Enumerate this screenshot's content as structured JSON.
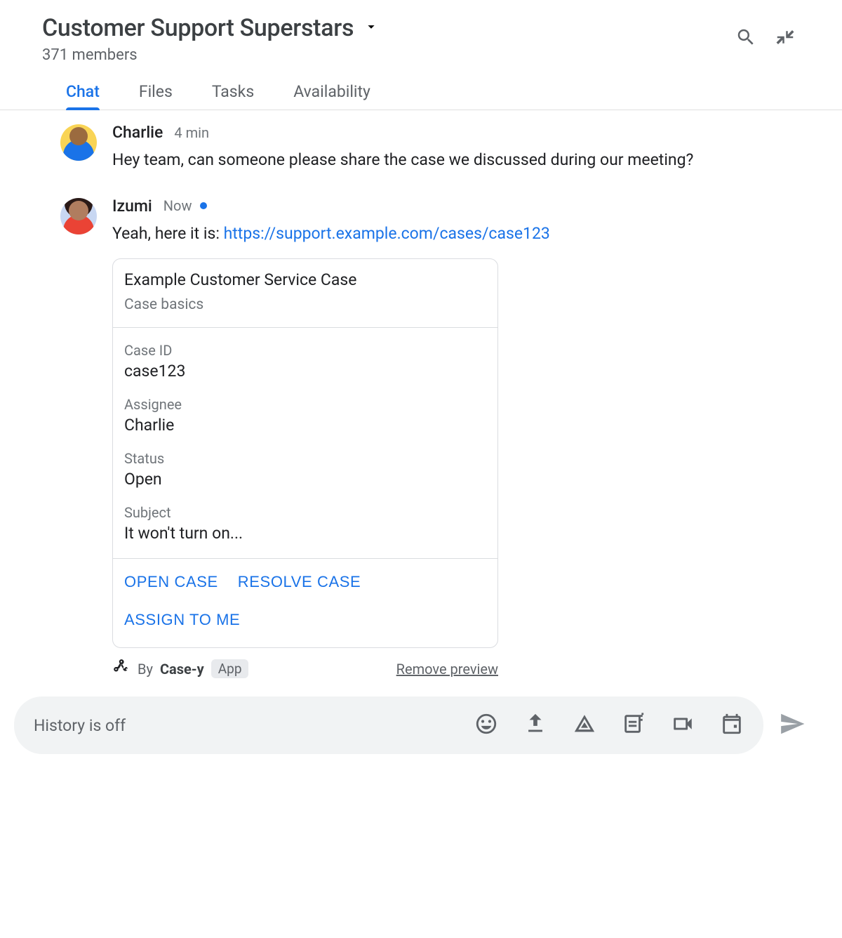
{
  "header": {
    "title": "Customer Support Superstars",
    "members": "371 members"
  },
  "tabs": [
    {
      "label": "Chat",
      "active": true
    },
    {
      "label": "Files",
      "active": false
    },
    {
      "label": "Tasks",
      "active": false
    },
    {
      "label": "Availability",
      "active": false
    }
  ],
  "messages": [
    {
      "author": "Charlie",
      "time": "4 min",
      "status_dot": false,
      "text": "Hey team, can someone please share the case we discussed during our meeting?"
    },
    {
      "author": "Izumi",
      "time": "Now",
      "status_dot": true,
      "text_prefix": "Yeah, here it is: ",
      "link_text": "https://support.example.com/cases/case123"
    }
  ],
  "card": {
    "title": "Example Customer Service Case",
    "subtitle": "Case basics",
    "fields": [
      {
        "label": "Case ID",
        "value": "case123"
      },
      {
        "label": "Assignee",
        "value": "Charlie"
      },
      {
        "label": "Status",
        "value": "Open"
      },
      {
        "label": "Subject",
        "value": "It won't turn on..."
      }
    ],
    "actions": [
      "OPEN CASE",
      "RESOLVE CASE",
      "ASSIGN TO ME"
    ],
    "meta": {
      "by_prefix": "By",
      "app_name": "Case-y",
      "app_badge": "App",
      "remove_text": "Remove preview"
    }
  },
  "composer": {
    "placeholder": "History is off"
  }
}
